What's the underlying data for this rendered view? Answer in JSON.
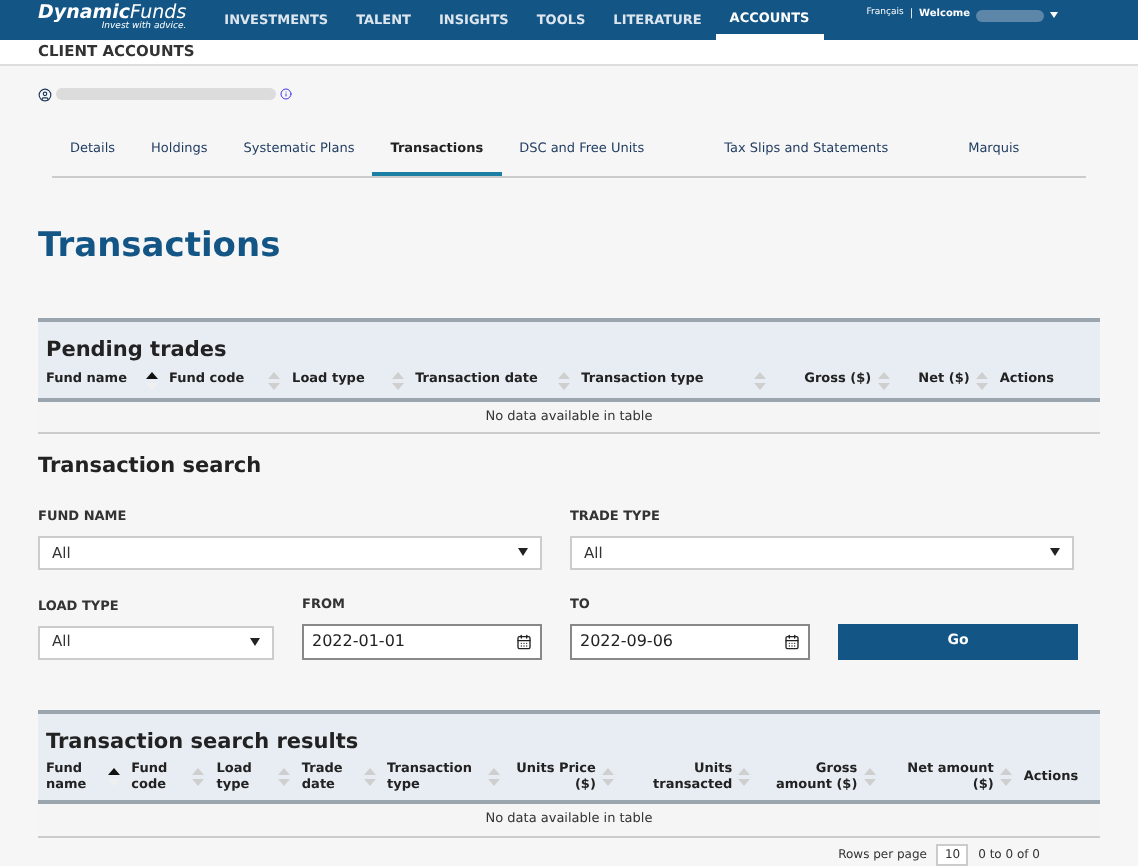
{
  "header": {
    "logo": {
      "brand": "Dynamic",
      "brand_light": "Funds",
      "tagline": "Invest with advice."
    },
    "nav": [
      {
        "label": "INVESTMENTS",
        "selected": false
      },
      {
        "label": "TALENT",
        "selected": false
      },
      {
        "label": "INSIGHTS",
        "selected": false
      },
      {
        "label": "TOOLS",
        "selected": false
      },
      {
        "label": "LITERATURE",
        "selected": false
      },
      {
        "label": "ACCOUNTS",
        "selected": true
      }
    ],
    "language": "Français",
    "separator": "|",
    "welcome": "Welcome"
  },
  "section_title": "CLIENT ACCOUNTS",
  "tabs": [
    {
      "label": "Details",
      "selected": false
    },
    {
      "label": "Holdings",
      "selected": false
    },
    {
      "label": "Systematic Plans",
      "selected": false
    },
    {
      "label": "Transactions",
      "selected": true
    },
    {
      "label": "DSC and Free Units",
      "selected": false
    },
    {
      "label": "Tax Slips and Statements",
      "selected": false
    },
    {
      "label": "Marquis",
      "selected": false
    }
  ],
  "page_title": "Transactions",
  "pending_trades": {
    "title": "Pending trades",
    "columns": [
      {
        "label": "Fund name",
        "sortable": true,
        "sorted": true,
        "numeric": false
      },
      {
        "label": "Fund code",
        "sortable": true,
        "sorted": false,
        "numeric": false
      },
      {
        "label": "Load type",
        "sortable": true,
        "sorted": false,
        "numeric": false
      },
      {
        "label": "Transaction date",
        "sortable": true,
        "sorted": false,
        "numeric": false
      },
      {
        "label": "Transaction type",
        "sortable": true,
        "sorted": false,
        "numeric": false
      },
      {
        "label": "Gross ($)",
        "sortable": true,
        "sorted": false,
        "numeric": true
      },
      {
        "label": "Net ($)",
        "sortable": true,
        "sorted": false,
        "numeric": true
      },
      {
        "label": "Actions",
        "sortable": false,
        "numeric": false
      }
    ],
    "empty_message": "No data available in table"
  },
  "search": {
    "title": "Transaction search",
    "fund_name": {
      "label": "FUND NAME",
      "value": "All"
    },
    "trade_type": {
      "label": "TRADE TYPE",
      "value": "All"
    },
    "load_type": {
      "label": "LOAD TYPE",
      "value": "All"
    },
    "from": {
      "label": "FROM",
      "value": "2022-01-01"
    },
    "to": {
      "label": "TO",
      "value": "2022-09-06"
    },
    "button": "Go"
  },
  "results": {
    "title": "Transaction search results",
    "columns": [
      {
        "label": "Fund name",
        "sortable": true,
        "sorted": true,
        "numeric": false
      },
      {
        "label": "Fund code",
        "sortable": true,
        "sorted": false,
        "numeric": false
      },
      {
        "label": "Load type",
        "sortable": true,
        "sorted": false,
        "numeric": false
      },
      {
        "label": "Trade date",
        "sortable": true,
        "sorted": false,
        "numeric": false
      },
      {
        "label": "Transaction type",
        "sortable": true,
        "sorted": false,
        "numeric": false
      },
      {
        "label": "Units Price ($)",
        "sortable": true,
        "sorted": false,
        "numeric": true
      },
      {
        "label": "Units transacted",
        "sortable": true,
        "sorted": false,
        "numeric": true
      },
      {
        "label": "Gross amount ($)",
        "sortable": true,
        "sorted": false,
        "numeric": true
      },
      {
        "label": "Net amount ($)",
        "sortable": true,
        "sorted": false,
        "numeric": true
      },
      {
        "label": "Actions",
        "sortable": false,
        "numeric": false
      }
    ],
    "empty_message": "No data available in table"
  },
  "pagination": {
    "rows_label": "Rows per page",
    "rows_value": "10",
    "range": "0 to 0 of 0"
  }
}
